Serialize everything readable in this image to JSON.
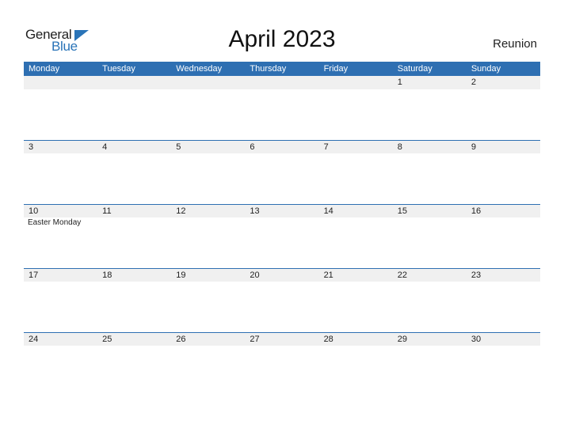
{
  "logo": {
    "word1": "General",
    "word2": "Blue"
  },
  "title": "April 2023",
  "country": "Reunion",
  "weekdays": [
    "Monday",
    "Tuesday",
    "Wednesday",
    "Thursday",
    "Friday",
    "Saturday",
    "Sunday"
  ],
  "weeks": [
    {
      "days": [
        "",
        "",
        "",
        "",
        "",
        "1",
        "2"
      ],
      "events": [
        "",
        "",
        "",
        "",
        "",
        "",
        ""
      ]
    },
    {
      "days": [
        "3",
        "4",
        "5",
        "6",
        "7",
        "8",
        "9"
      ],
      "events": [
        "",
        "",
        "",
        "",
        "",
        "",
        ""
      ]
    },
    {
      "days": [
        "10",
        "11",
        "12",
        "13",
        "14",
        "15",
        "16"
      ],
      "events": [
        "Easter Monday",
        "",
        "",
        "",
        "",
        "",
        ""
      ]
    },
    {
      "days": [
        "17",
        "18",
        "19",
        "20",
        "21",
        "22",
        "23"
      ],
      "events": [
        "",
        "",
        "",
        "",
        "",
        "",
        ""
      ]
    },
    {
      "days": [
        "24",
        "25",
        "26",
        "27",
        "28",
        "29",
        "30"
      ],
      "events": [
        "",
        "",
        "",
        "",
        "",
        "",
        ""
      ]
    }
  ],
  "colors": {
    "accent": "#2e6fb2",
    "strip": "#f0f0f0"
  }
}
